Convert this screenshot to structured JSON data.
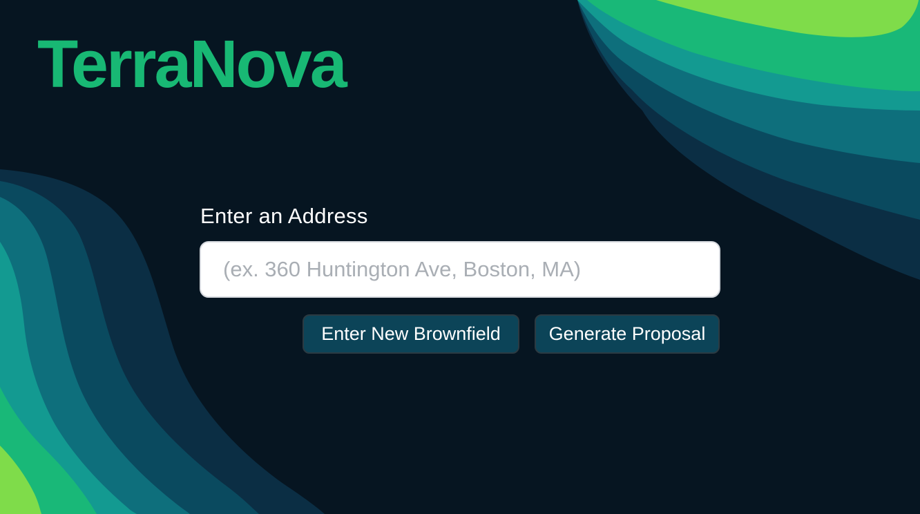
{
  "app": {
    "logo_text": "TerraNova"
  },
  "address_form": {
    "label": "Enter an Address",
    "input_value": "",
    "input_placeholder": "(ex. 360 Huntington Ave, Boston, MA)"
  },
  "actions": {
    "new_brownfield_label": "Enter New Brownfield",
    "generate_proposal_label": "Generate Proposal"
  },
  "colors": {
    "background": "#061521",
    "brand_green": "#18b874",
    "button_fill": "#0c4458",
    "wave_palette": [
      "#0b3d52",
      "#0e6b7a",
      "#12968f",
      "#1dba76",
      "#7bdb4a"
    ]
  }
}
